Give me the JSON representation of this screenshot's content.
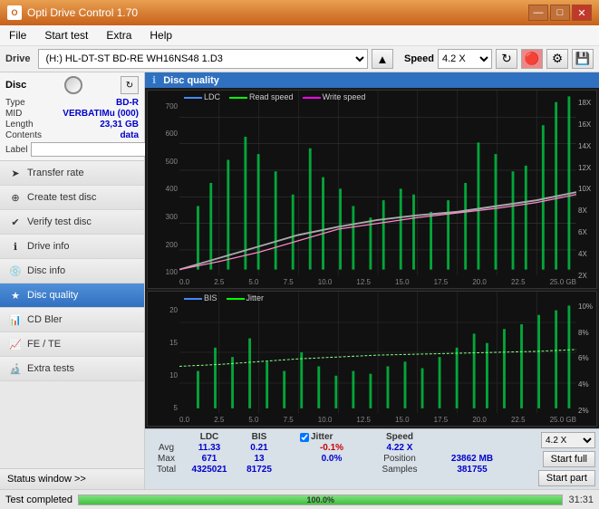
{
  "titleBar": {
    "title": "Opti Drive Control 1.70",
    "minBtn": "—",
    "maxBtn": "□",
    "closeBtn": "✕"
  },
  "menuBar": {
    "items": [
      "File",
      "Start test",
      "Extra",
      "Help"
    ]
  },
  "driveBar": {
    "label": "Drive",
    "driveValue": "(H:)  HL-DT-ST BD-RE  WH16NS48 1.D3",
    "speedLabel": "Speed",
    "speedValue": "4.2 X"
  },
  "disc": {
    "title": "Disc",
    "rows": [
      {
        "key": "Type",
        "val": "BD-R"
      },
      {
        "key": "MID",
        "val": "VERBATIMu (000)"
      },
      {
        "key": "Length",
        "val": "23,31 GB"
      },
      {
        "key": "Contents",
        "val": "data"
      },
      {
        "key": "Label",
        "val": ""
      }
    ]
  },
  "nav": {
    "items": [
      {
        "label": "Transfer rate",
        "icon": "➤",
        "active": false
      },
      {
        "label": "Create test disc",
        "icon": "⊕",
        "active": false
      },
      {
        "label": "Verify test disc",
        "icon": "✔",
        "active": false
      },
      {
        "label": "Drive info",
        "icon": "ℹ",
        "active": false
      },
      {
        "label": "Disc info",
        "icon": "💿",
        "active": false
      },
      {
        "label": "Disc quality",
        "icon": "★",
        "active": true
      },
      {
        "label": "CD Bler",
        "icon": "📊",
        "active": false
      },
      {
        "label": "FE / TE",
        "icon": "📈",
        "active": false
      },
      {
        "label": "Extra tests",
        "icon": "🔬",
        "active": false
      }
    ]
  },
  "statusWindow": {
    "label": "Status window >>",
    "arrows": ">>"
  },
  "chartPanel": {
    "title": "Disc quality",
    "legend": {
      "ldc": "LDC",
      "readSpeed": "Read speed",
      "writeSpeed": "Write speed"
    },
    "legend2": {
      "bis": "BIS",
      "jitter": "Jitter"
    },
    "upperYLeft": [
      "700",
      "600",
      "500",
      "400",
      "300",
      "200",
      "100"
    ],
    "upperYRight": [
      "18X",
      "16X",
      "14X",
      "12X",
      "10X",
      "8X",
      "6X",
      "4X",
      "2X"
    ],
    "xAxis": [
      "0.0",
      "2.5",
      "5.0",
      "7.5",
      "10.0",
      "12.5",
      "15.0",
      "17.5",
      "20.0",
      "22.5",
      "25.0 GB"
    ],
    "lowerYLeft": [
      "20",
      "15",
      "10",
      "5"
    ],
    "lowerYRight": [
      "10%",
      "8%",
      "6%",
      "4%",
      "2%"
    ],
    "xAxis2": [
      "0.0",
      "2.5",
      "5.0",
      "7.5",
      "10.0",
      "12.5",
      "15.0",
      "17.5",
      "20.0",
      "22.5",
      "25.0 GB"
    ]
  },
  "stats": {
    "headers": [
      "",
      "LDC",
      "BIS",
      "",
      "Jitter",
      "Speed",
      ""
    ],
    "avgRow": [
      "Avg",
      "11.33",
      "0.21",
      "",
      "-0.1%",
      "4.22 X",
      ""
    ],
    "maxRow": [
      "Max",
      "671",
      "13",
      "",
      "0.0%",
      "Position",
      "23862 MB"
    ],
    "totalRow": [
      "Total",
      "4325021",
      "81725",
      "",
      "",
      "Samples",
      "381755"
    ],
    "jitterChecked": true,
    "speedDropdown": "4.2 X",
    "startFull": "Start full",
    "startPart": "Start part"
  },
  "bottomBar": {
    "statusText": "Test completed",
    "progress": 100,
    "progressLabel": "100.0%",
    "time": "31:31"
  },
  "colors": {
    "accent": "#3070c0",
    "green": "#40c040",
    "titleBg": "#c8601a"
  }
}
